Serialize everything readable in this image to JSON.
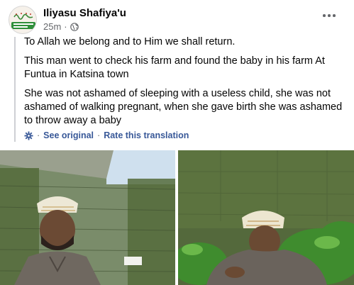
{
  "post": {
    "author": "Iliyasu Shafiya'u",
    "timestamp": "25m",
    "separator": "·",
    "privacy_icon": "globe-icon",
    "more_icon": "more-options-icon",
    "paragraphs": [
      "To Allah we belong and to Him we shall return.",
      "This man went to check his farm and found the baby in his farm At Funtua in Katsina town",
      "She was not ashamed of sleeping with a useless child, she was not ashamed of walking pregnant, when she gave birth she was ashamed to throw away a baby"
    ],
    "translation": {
      "see_original": "See original",
      "dot": "·",
      "rate": "Rate this translation"
    }
  },
  "colors": {
    "link": "#385898",
    "meta_text": "#65676b",
    "quote_bar": "#ced0d4"
  }
}
